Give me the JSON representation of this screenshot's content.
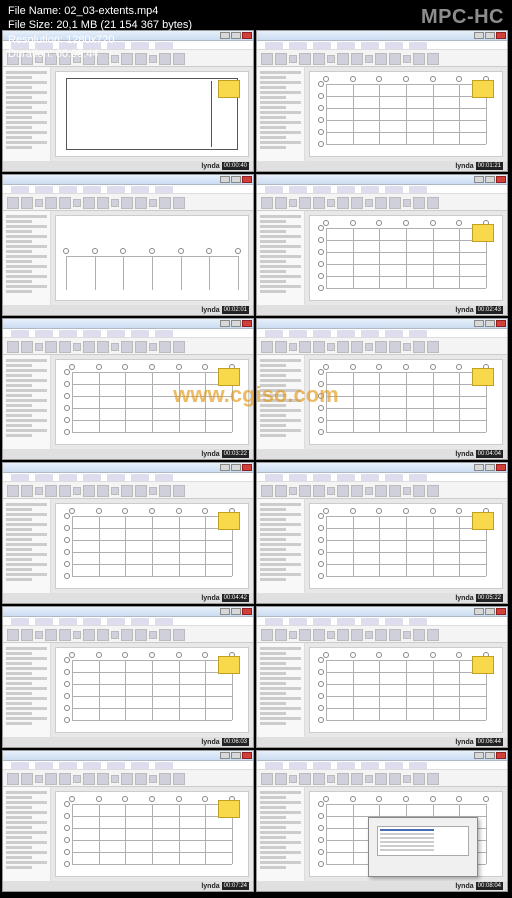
{
  "app": {
    "player_name": "MPC-HC",
    "file_label": "File Name:",
    "file_name": "02_03-extents.mp4",
    "size_label": "File Size:",
    "file_size": "20,1 MB (21 154 367 bytes)",
    "res_label": "Resolution:",
    "resolution": "1280x720",
    "dur_label": "Duration:",
    "duration": "00:08:44"
  },
  "watermark": "www.cgiso.com",
  "logo_text": "lynda",
  "thumbs": [
    {
      "ts": "00:00:40",
      "kind": "sheet",
      "note": true
    },
    {
      "ts": "00:01:21",
      "kind": "grid",
      "note": true
    },
    {
      "ts": "00:02:01",
      "kind": "sheet2",
      "note": false
    },
    {
      "ts": "00:02:43",
      "kind": "grid",
      "note": true
    },
    {
      "ts": "00:03:22",
      "kind": "grid",
      "note": true
    },
    {
      "ts": "00:04:04",
      "kind": "grid",
      "note": true
    },
    {
      "ts": "00:04:42",
      "kind": "grid",
      "note": true
    },
    {
      "ts": "00:05:22",
      "kind": "grid",
      "note": true
    },
    {
      "ts": "00:06:03",
      "kind": "grid",
      "note": true
    },
    {
      "ts": "00:06:44",
      "kind": "grid",
      "note": true
    },
    {
      "ts": "00:07:24",
      "kind": "grid",
      "note": true
    },
    {
      "ts": "00:08:04",
      "kind": "dialog",
      "note": false
    }
  ]
}
